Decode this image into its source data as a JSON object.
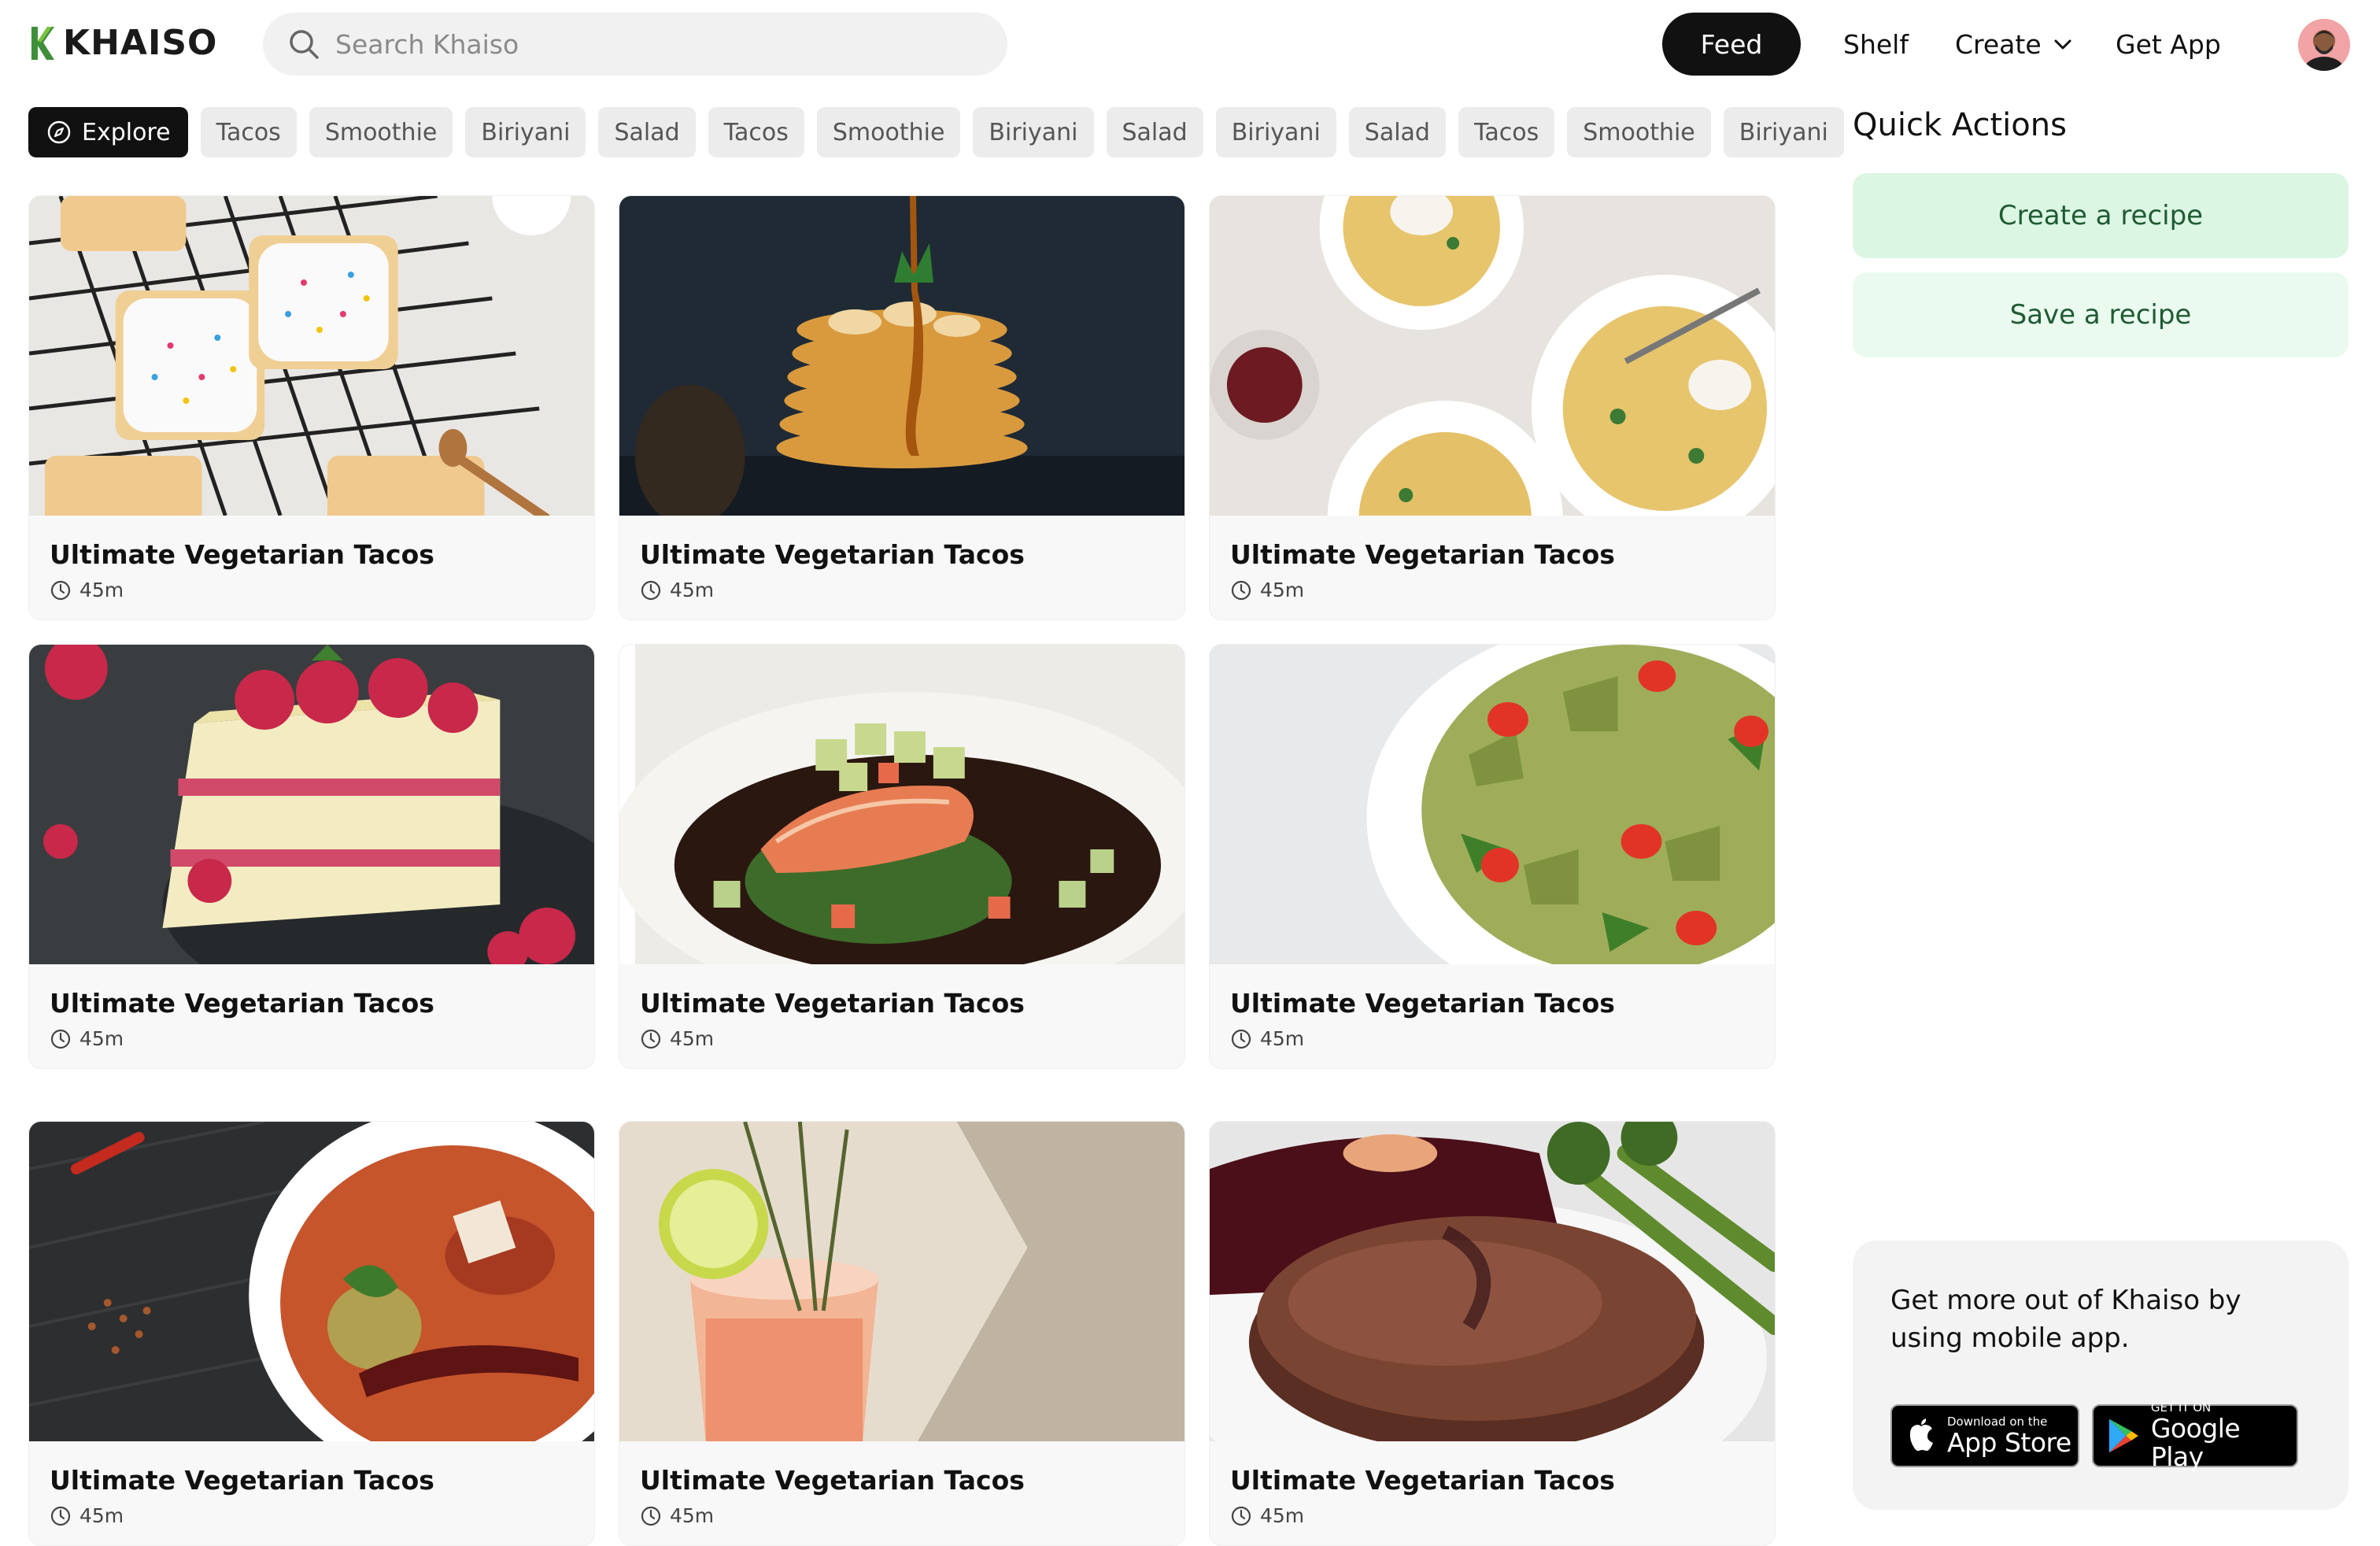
{
  "app": {
    "name": "KHAISO",
    "accent": "#2e7d32"
  },
  "search": {
    "placeholder": "Search Khaiso",
    "icon": "search-icon"
  },
  "nav": {
    "feed": "Feed",
    "shelf": "Shelf",
    "create": "Create",
    "get_app": "Get App"
  },
  "chips": {
    "explore": "Explore",
    "items": [
      "Tacos",
      "Smoothie",
      "Biriyani",
      "Salad",
      "Tacos",
      "Smoothie",
      "Biriyani",
      "Salad",
      "Biriyani",
      "Salad",
      "Tacos",
      "Smoothie",
      "Biriyani"
    ]
  },
  "recipes": [
    {
      "title": "Ultimate Vegetarian Tacos",
      "time": "45m",
      "image": "pop-tarts"
    },
    {
      "title": "Ultimate Vegetarian Tacos",
      "time": "45m",
      "image": "pancake-stack"
    },
    {
      "title": "Ultimate Vegetarian Tacos",
      "time": "45m",
      "image": "spaghetti-plates"
    },
    {
      "title": "Ultimate Vegetarian Tacos",
      "time": "45m",
      "image": "raspberry-cake"
    },
    {
      "title": "Ultimate Vegetarian Tacos",
      "time": "45m",
      "image": "salmon-dish"
    },
    {
      "title": "Ultimate Vegetarian Tacos",
      "time": "45m",
      "image": "pesto-pasta"
    },
    {
      "title": "Ultimate Vegetarian Tacos",
      "time": "45m",
      "image": "red-stew"
    },
    {
      "title": "Ultimate Vegetarian Tacos",
      "time": "45m",
      "image": "cocktail"
    },
    {
      "title": "Ultimate Vegetarian Tacos",
      "time": "45m",
      "image": "steak"
    }
  ],
  "quick_actions": {
    "title": "Quick Actions",
    "create": "Create a recipe",
    "save": "Save a recipe"
  },
  "promo": {
    "text": "Get more out of Khaiso by using mobile app.",
    "app_store_small": "Download on the",
    "app_store_big": "App Store",
    "google_small": "GET IT ON",
    "google_big": "Google Play"
  }
}
